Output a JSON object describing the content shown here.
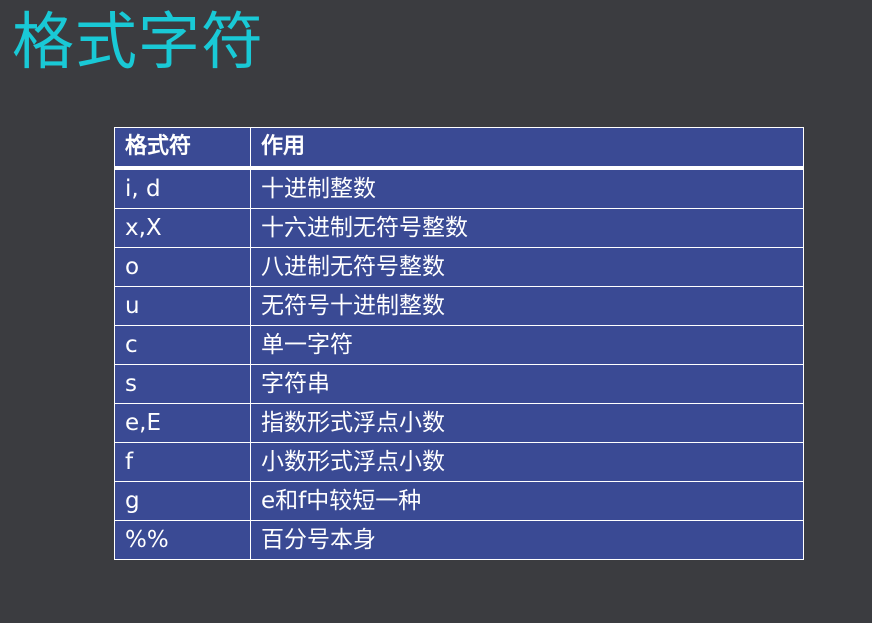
{
  "title": "格式字符",
  "table": {
    "headers": [
      "格式符",
      "作用"
    ],
    "rows": [
      [
        "i, d",
        "十进制整数"
      ],
      [
        "x,X",
        "十六进制无符号整数"
      ],
      [
        "o",
        "八进制无符号整数"
      ],
      [
        "u",
        "无符号十进制整数"
      ],
      [
        "c",
        "单一字符"
      ],
      [
        "s",
        "字符串"
      ],
      [
        "e,E",
        "指数形式浮点小数"
      ],
      [
        "f",
        "小数形式浮点小数"
      ],
      [
        "g",
        "e和f中较短一种"
      ],
      [
        "%%",
        "百分号本身"
      ]
    ]
  },
  "colors": {
    "background": "#3b3c40",
    "title": "#19c9d6",
    "table_fill": "#3a4a94",
    "table_border": "#ffffff"
  }
}
